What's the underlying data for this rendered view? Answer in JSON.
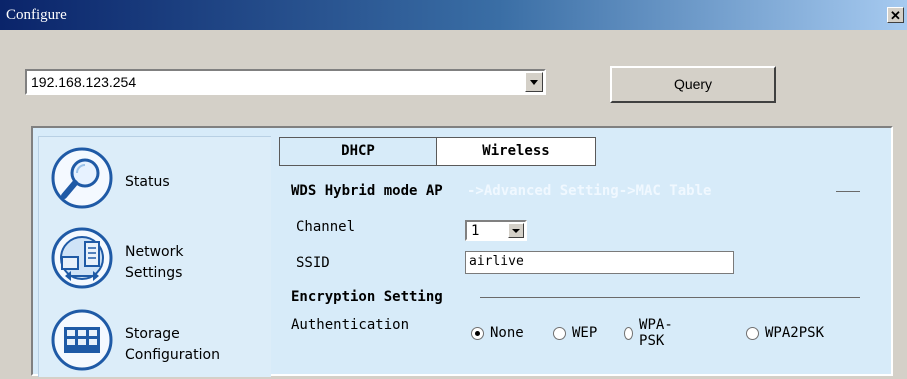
{
  "window": {
    "title": "Configure",
    "close_glyph": "✕"
  },
  "device": {
    "ip_value": "192.168.123.254",
    "query_label": "Query"
  },
  "sidebar": {
    "items": [
      {
        "label_line1": "Status",
        "label_line2": "",
        "icon": "magnifier-icon"
      },
      {
        "label_line1": "Network",
        "label_line2": "Settings",
        "icon": "network-icon"
      },
      {
        "label_line1": "Storage",
        "label_line2": "Configuration",
        "icon": "storage-icon"
      }
    ]
  },
  "tabs": [
    {
      "label": "DHCP",
      "active": false
    },
    {
      "label": "Wireless",
      "active": true
    }
  ],
  "wireless": {
    "mode_title": "WDS Hybrid mode AP",
    "mode_ghost": "->Advanced Setting->MAC Table",
    "channel_label": "Channel",
    "channel_value": "1",
    "ssid_label": "SSID",
    "ssid_value": "airlive",
    "encryption_title": "Encryption Setting",
    "auth_label": "Authentication",
    "auth_options": [
      "None",
      "WEP",
      "WPA-PSK",
      "WPA2PSK"
    ],
    "auth_selected": "None"
  },
  "colors": {
    "title_start": "#0a246a",
    "title_end": "#a6caf0",
    "panel_bg": "#d7ebf9",
    "icon_blue": "#1f5aa6"
  }
}
